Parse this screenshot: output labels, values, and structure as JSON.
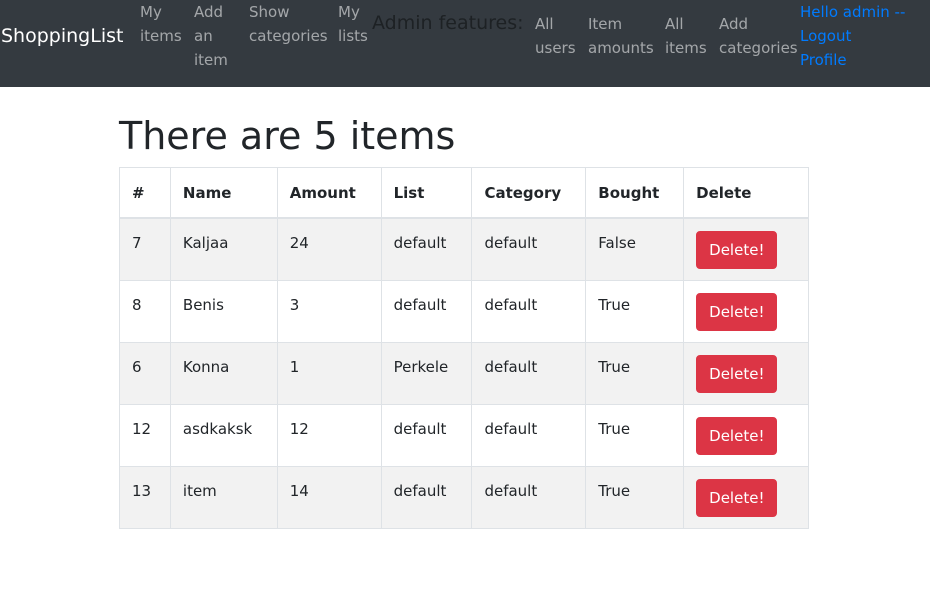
{
  "nav": {
    "brand": "ShoppingList",
    "links": [
      {
        "lines": [
          "My",
          "items"
        ]
      },
      {
        "lines": [
          "Add",
          "an",
          "item"
        ]
      },
      {
        "lines": [
          "Show",
          "categories"
        ]
      },
      {
        "lines": [
          "My",
          "lists"
        ]
      }
    ],
    "admin_label": "Admin features:",
    "admin_links": [
      {
        "lines": [
          "All",
          "users"
        ]
      },
      {
        "lines": [
          "Item",
          "amounts"
        ]
      },
      {
        "lines": [
          "All",
          "items"
        ]
      },
      {
        "lines": [
          "Add",
          "categories"
        ]
      }
    ],
    "user": {
      "hello": "Hello admin --",
      "logout": "Logout",
      "profile": "Profile"
    }
  },
  "page": {
    "title": "There are 5 items"
  },
  "table": {
    "headers": [
      "#",
      "Name",
      "Amount",
      "List",
      "Category",
      "Bought",
      "Delete"
    ],
    "rows": [
      {
        "id": "7",
        "name": "Kaljaa",
        "amount": "24",
        "list": "default",
        "category": "default",
        "bought": "False",
        "action": "Delete!"
      },
      {
        "id": "8",
        "name": "Benis",
        "amount": "3",
        "list": "default",
        "category": "default",
        "bought": "True",
        "action": "Delete!"
      },
      {
        "id": "6",
        "name": "Konna",
        "amount": "1",
        "list": "Perkele",
        "category": "default",
        "bought": "True",
        "action": "Delete!"
      },
      {
        "id": "12",
        "name": "asdkaksk",
        "amount": "12",
        "list": "default",
        "category": "default",
        "bought": "True",
        "action": "Delete!"
      },
      {
        "id": "13",
        "name": "item",
        "amount": "14",
        "list": "default",
        "category": "default",
        "bought": "True",
        "action": "Delete!"
      }
    ]
  },
  "colors": {
    "navbar_bg": "#343a40",
    "link_blue": "#007bff",
    "danger": "#dc3545",
    "stripe": "#f2f2f2"
  }
}
